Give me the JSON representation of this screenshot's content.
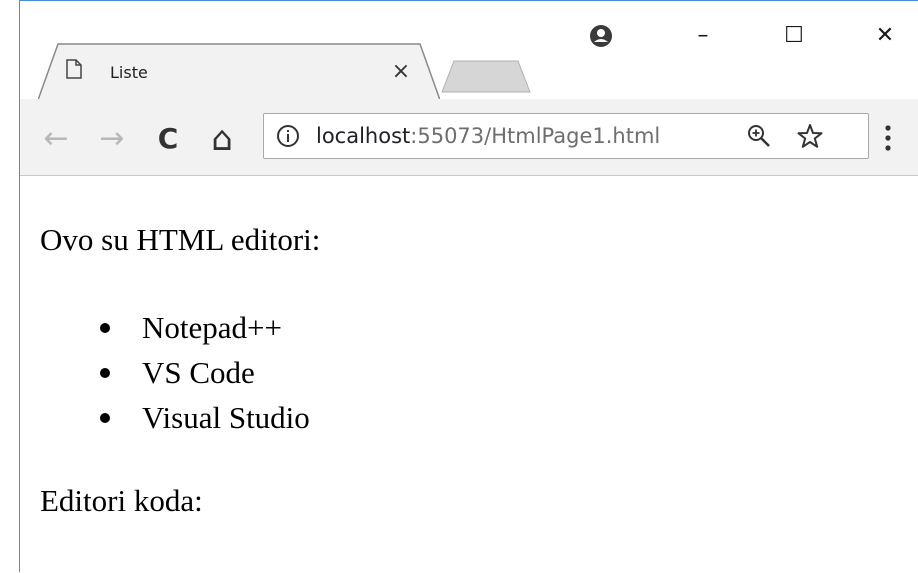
{
  "browser": {
    "tab": {
      "title": "Liste",
      "close": "×"
    },
    "window_controls": {
      "minimize": "–",
      "maximize": "☐",
      "close": "✕"
    },
    "toolbar": {
      "back": "←",
      "forward": "→",
      "reload": "C",
      "home": "⌂",
      "url_host": "localhost",
      "url_path": ":55073/HtmlPage1.html"
    },
    "accent_color": "#4a8fd6"
  },
  "page": {
    "intro": "Ovo su HTML editori:",
    "editors": [
      "Notepad++",
      "VS Code",
      "Visual Studio"
    ],
    "section2": "Editori koda:"
  }
}
